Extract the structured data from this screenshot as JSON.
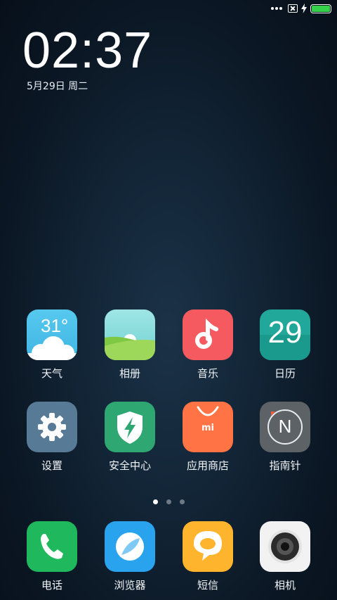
{
  "status": {
    "battery_color": "#35d14b"
  },
  "clock": {
    "time": "02:37",
    "date": "5月29日 周二"
  },
  "apps": [
    {
      "label": "天气",
      "icon": "weather-icon",
      "temp": "31°",
      "color": "#4dc3ea"
    },
    {
      "label": "相册",
      "icon": "gallery-icon",
      "color": "#8ed35a"
    },
    {
      "label": "音乐",
      "icon": "music-icon",
      "color": "#f45a60"
    },
    {
      "label": "日历",
      "icon": "calendar-icon",
      "day": "29",
      "color": "#21a89a"
    },
    {
      "label": "设置",
      "icon": "settings-icon",
      "color": "#577a96"
    },
    {
      "label": "安全中心",
      "icon": "security-icon",
      "color": "#2fa772"
    },
    {
      "label": "应用商店",
      "icon": "app-store-icon",
      "brand": "mi",
      "color": "#ff7344"
    },
    {
      "label": "指南针",
      "icon": "compass-icon",
      "letter": "N",
      "color": "#5c6266"
    }
  ],
  "dock": [
    {
      "label": "电话",
      "icon": "phone-icon",
      "color": "#1fb85c"
    },
    {
      "label": "浏览器",
      "icon": "browser-icon",
      "color": "#2aa3ef"
    },
    {
      "label": "短信",
      "icon": "messages-icon",
      "color": "#ffb42e"
    },
    {
      "label": "相机",
      "icon": "camera-icon",
      "color": "#f2f2f2"
    }
  ],
  "pager": {
    "pages": 3,
    "active": 0
  }
}
